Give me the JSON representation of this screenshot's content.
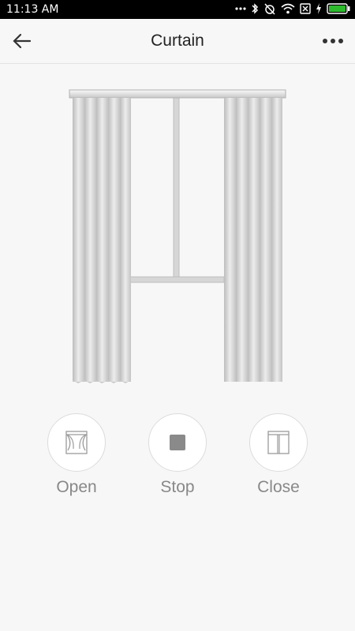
{
  "status_bar": {
    "time": "11:13 AM"
  },
  "app_bar": {
    "title": "Curtain"
  },
  "controls": [
    {
      "id": "open",
      "label": "Open"
    },
    {
      "id": "stop",
      "label": "Stop"
    },
    {
      "id": "close",
      "label": "Close"
    }
  ],
  "colors": {
    "background": "#f7f7f7",
    "label": "#888888",
    "battery": "#2dbb2d"
  }
}
